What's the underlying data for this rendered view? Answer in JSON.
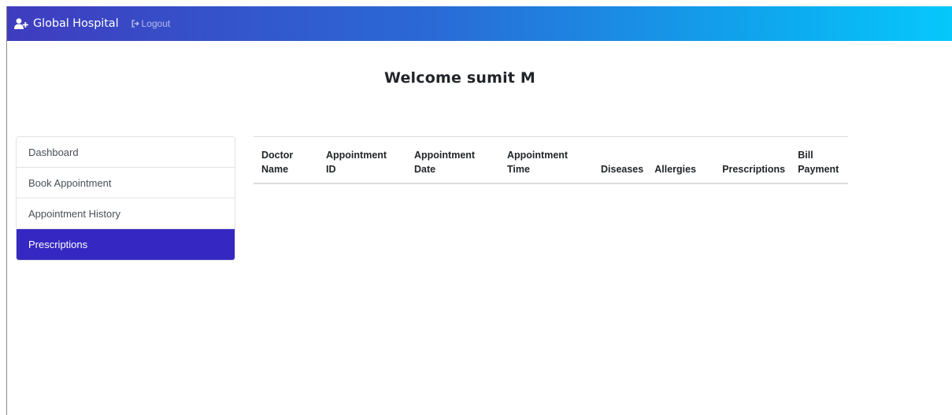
{
  "navbar": {
    "brand_icon": "user-plus-icon",
    "brand": "Global Hospital",
    "logout_icon": "sign-out-icon",
    "logout": "Logout"
  },
  "welcome": "Welcome  sumit M",
  "sidebar": {
    "items": [
      {
        "label": "Dashboard",
        "active": false
      },
      {
        "label": "Book Appointment",
        "active": false
      },
      {
        "label": "Appointment History",
        "active": false
      },
      {
        "label": "Prescriptions",
        "active": true
      }
    ]
  },
  "table": {
    "columns": [
      "Doctor\nName",
      "Appointment\nID",
      "Appointment\nDate",
      "Appointment\nTime",
      "Diseases",
      "Allergies",
      "Prescriptions",
      "Bill\nPayment"
    ],
    "rows": []
  },
  "colors": {
    "nav_start": "#3f3cbf",
    "nav_end": "#06c8fb",
    "active_item": "#3528c2"
  }
}
